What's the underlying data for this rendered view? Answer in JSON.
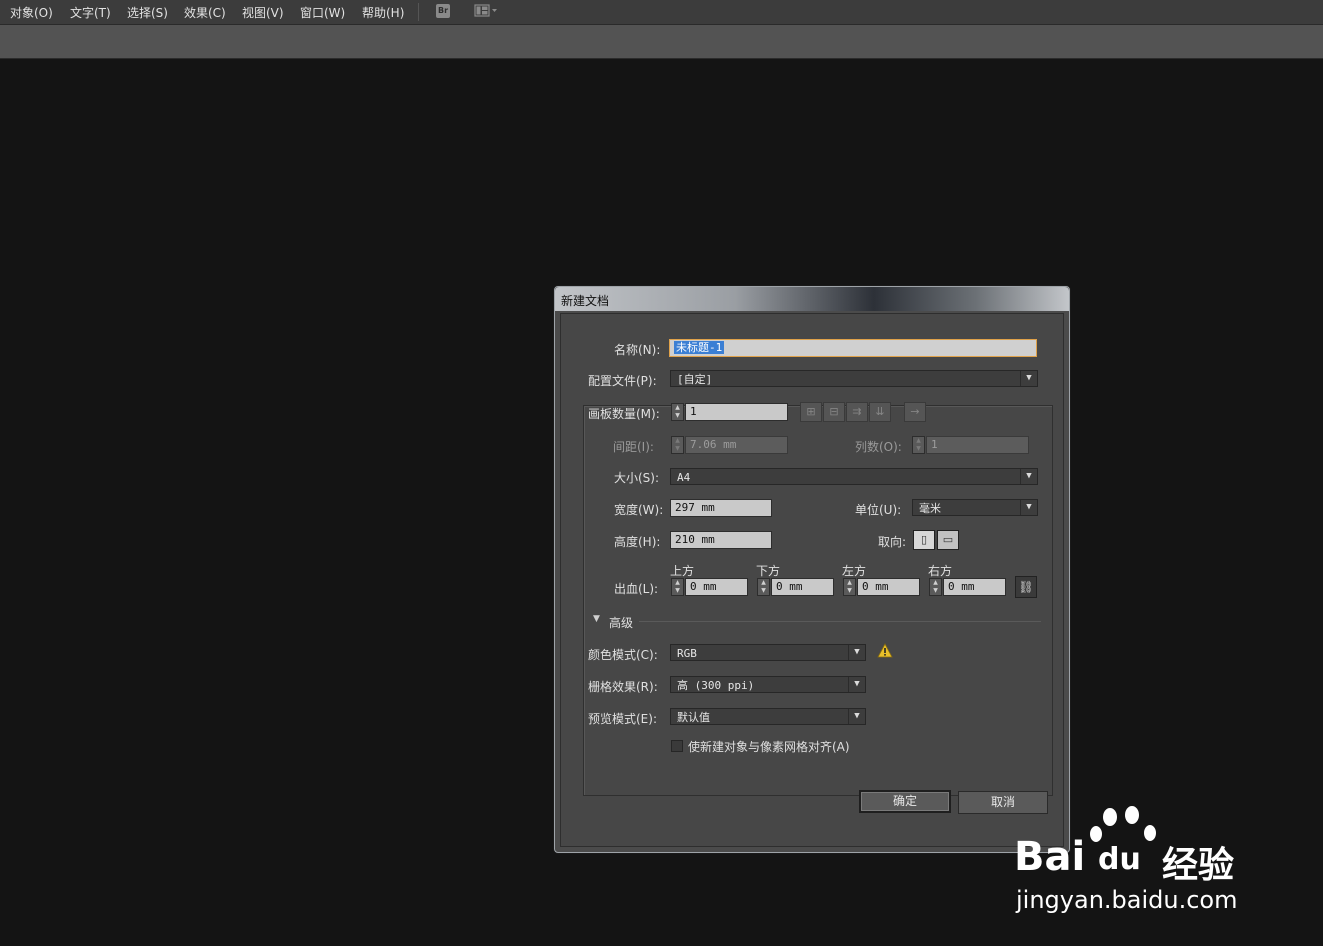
{
  "menu": {
    "items": [
      "对象(O)",
      "文字(T)",
      "选择(S)",
      "效果(C)",
      "视图(V)",
      "窗口(W)",
      "帮助(H)"
    ],
    "bridge_icon": "Br"
  },
  "dialog": {
    "title": "新建文档",
    "name_label": "名称(N):",
    "name_value": "未标题-1",
    "profile_label": "配置文件(P):",
    "profile_value": "[自定]",
    "artboards_label": "画板数量(M):",
    "artboards_value": "1",
    "spacing_label": "间距(I):",
    "spacing_value": "7.06 mm",
    "columns_label": "列数(O):",
    "columns_value": "1",
    "size_label": "大小(S):",
    "size_value": "A4",
    "width_label": "宽度(W):",
    "width_value": "297 mm",
    "units_label": "单位(U):",
    "units_value": "毫米",
    "height_label": "高度(H):",
    "height_value": "210 mm",
    "orientation_label": "取向:",
    "bleed_label": "出血(L):",
    "bleed": {
      "top_label": "上方",
      "top_value": "0 mm",
      "bottom_label": "下方",
      "bottom_value": "0 mm",
      "left_label": "左方",
      "left_value": "0 mm",
      "right_label": "右方",
      "right_value": "0 mm"
    },
    "advanced_label": "高级",
    "color_mode_label": "颜色模式(C):",
    "color_mode_value": "RGB",
    "raster_label": "栅格效果(R):",
    "raster_value": "高 (300 ppi)",
    "preview_label": "预览模式(E):",
    "preview_value": "默认值",
    "align_pixel_label": "使新建对象与像素网格对齐(A)",
    "align_pixel_checked": false,
    "ok_label": "确定",
    "cancel_label": "取消"
  },
  "watermark": {
    "brand": "Bai",
    "brand_suffix": "du",
    "brand_cn": "经验",
    "url": "jingyan.baidu.com"
  },
  "colors": {
    "focus_border": "#e0a24a",
    "selection": "#3b7fd4",
    "warning": "#e8c02a"
  }
}
